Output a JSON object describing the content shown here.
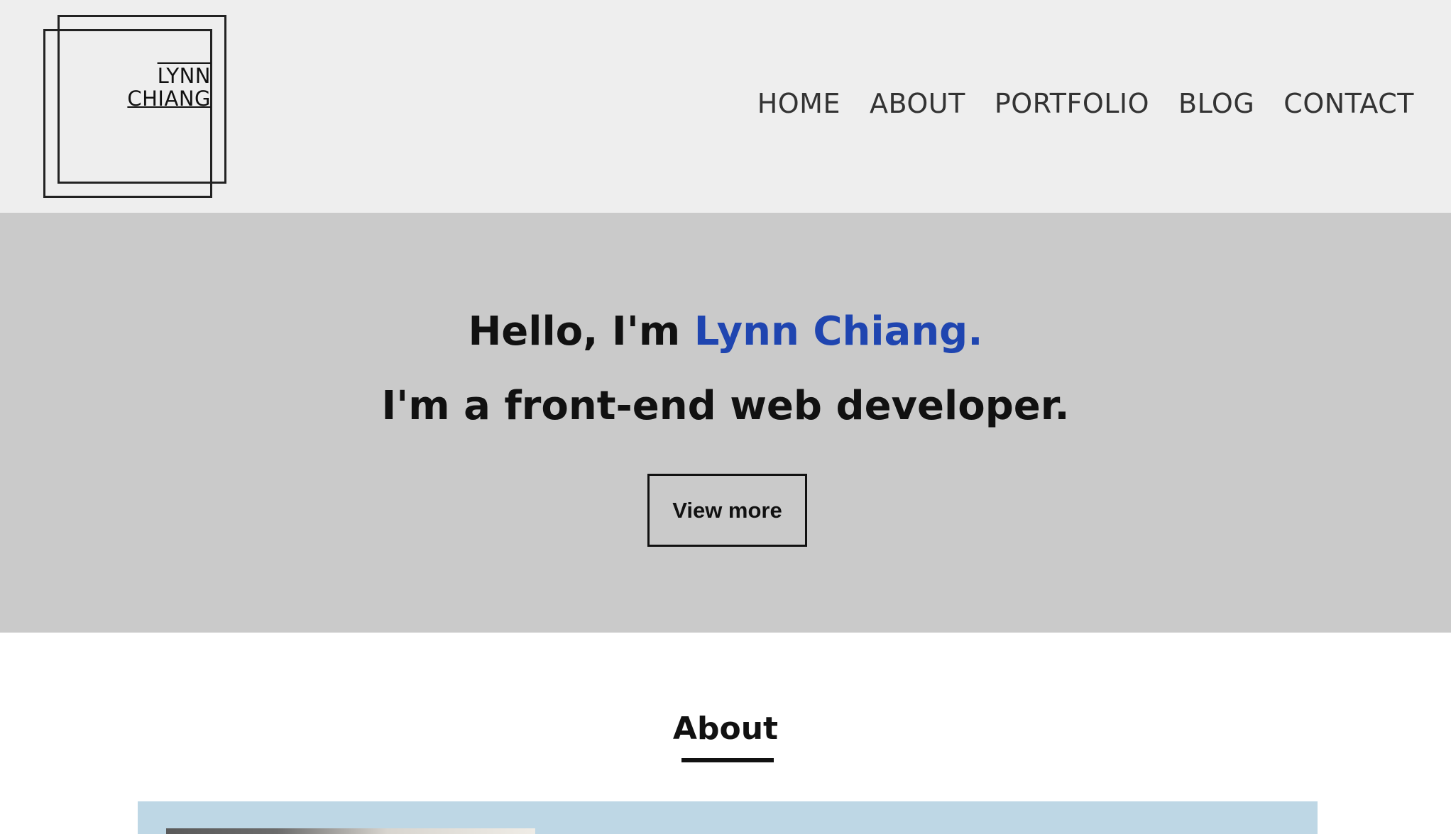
{
  "logo": {
    "line1": "LYNN",
    "line2": "CHIANG"
  },
  "nav": {
    "items": [
      {
        "label": "HOME"
      },
      {
        "label": "ABOUT"
      },
      {
        "label": "PORTFOLIO"
      },
      {
        "label": "BLOG"
      },
      {
        "label": "CONTACT"
      }
    ]
  },
  "hero": {
    "greeting": "Hello, I'm ",
    "name": "Lynn Chiang.",
    "tagline": "I'm a front-end web developer.",
    "button_label": "View more"
  },
  "about": {
    "heading": "About"
  },
  "colors": {
    "header_bg": "#eeeeee",
    "hero_bg": "#cacaca",
    "accent": "#1f45b0",
    "about_panel_bg": "#bed7e5"
  }
}
